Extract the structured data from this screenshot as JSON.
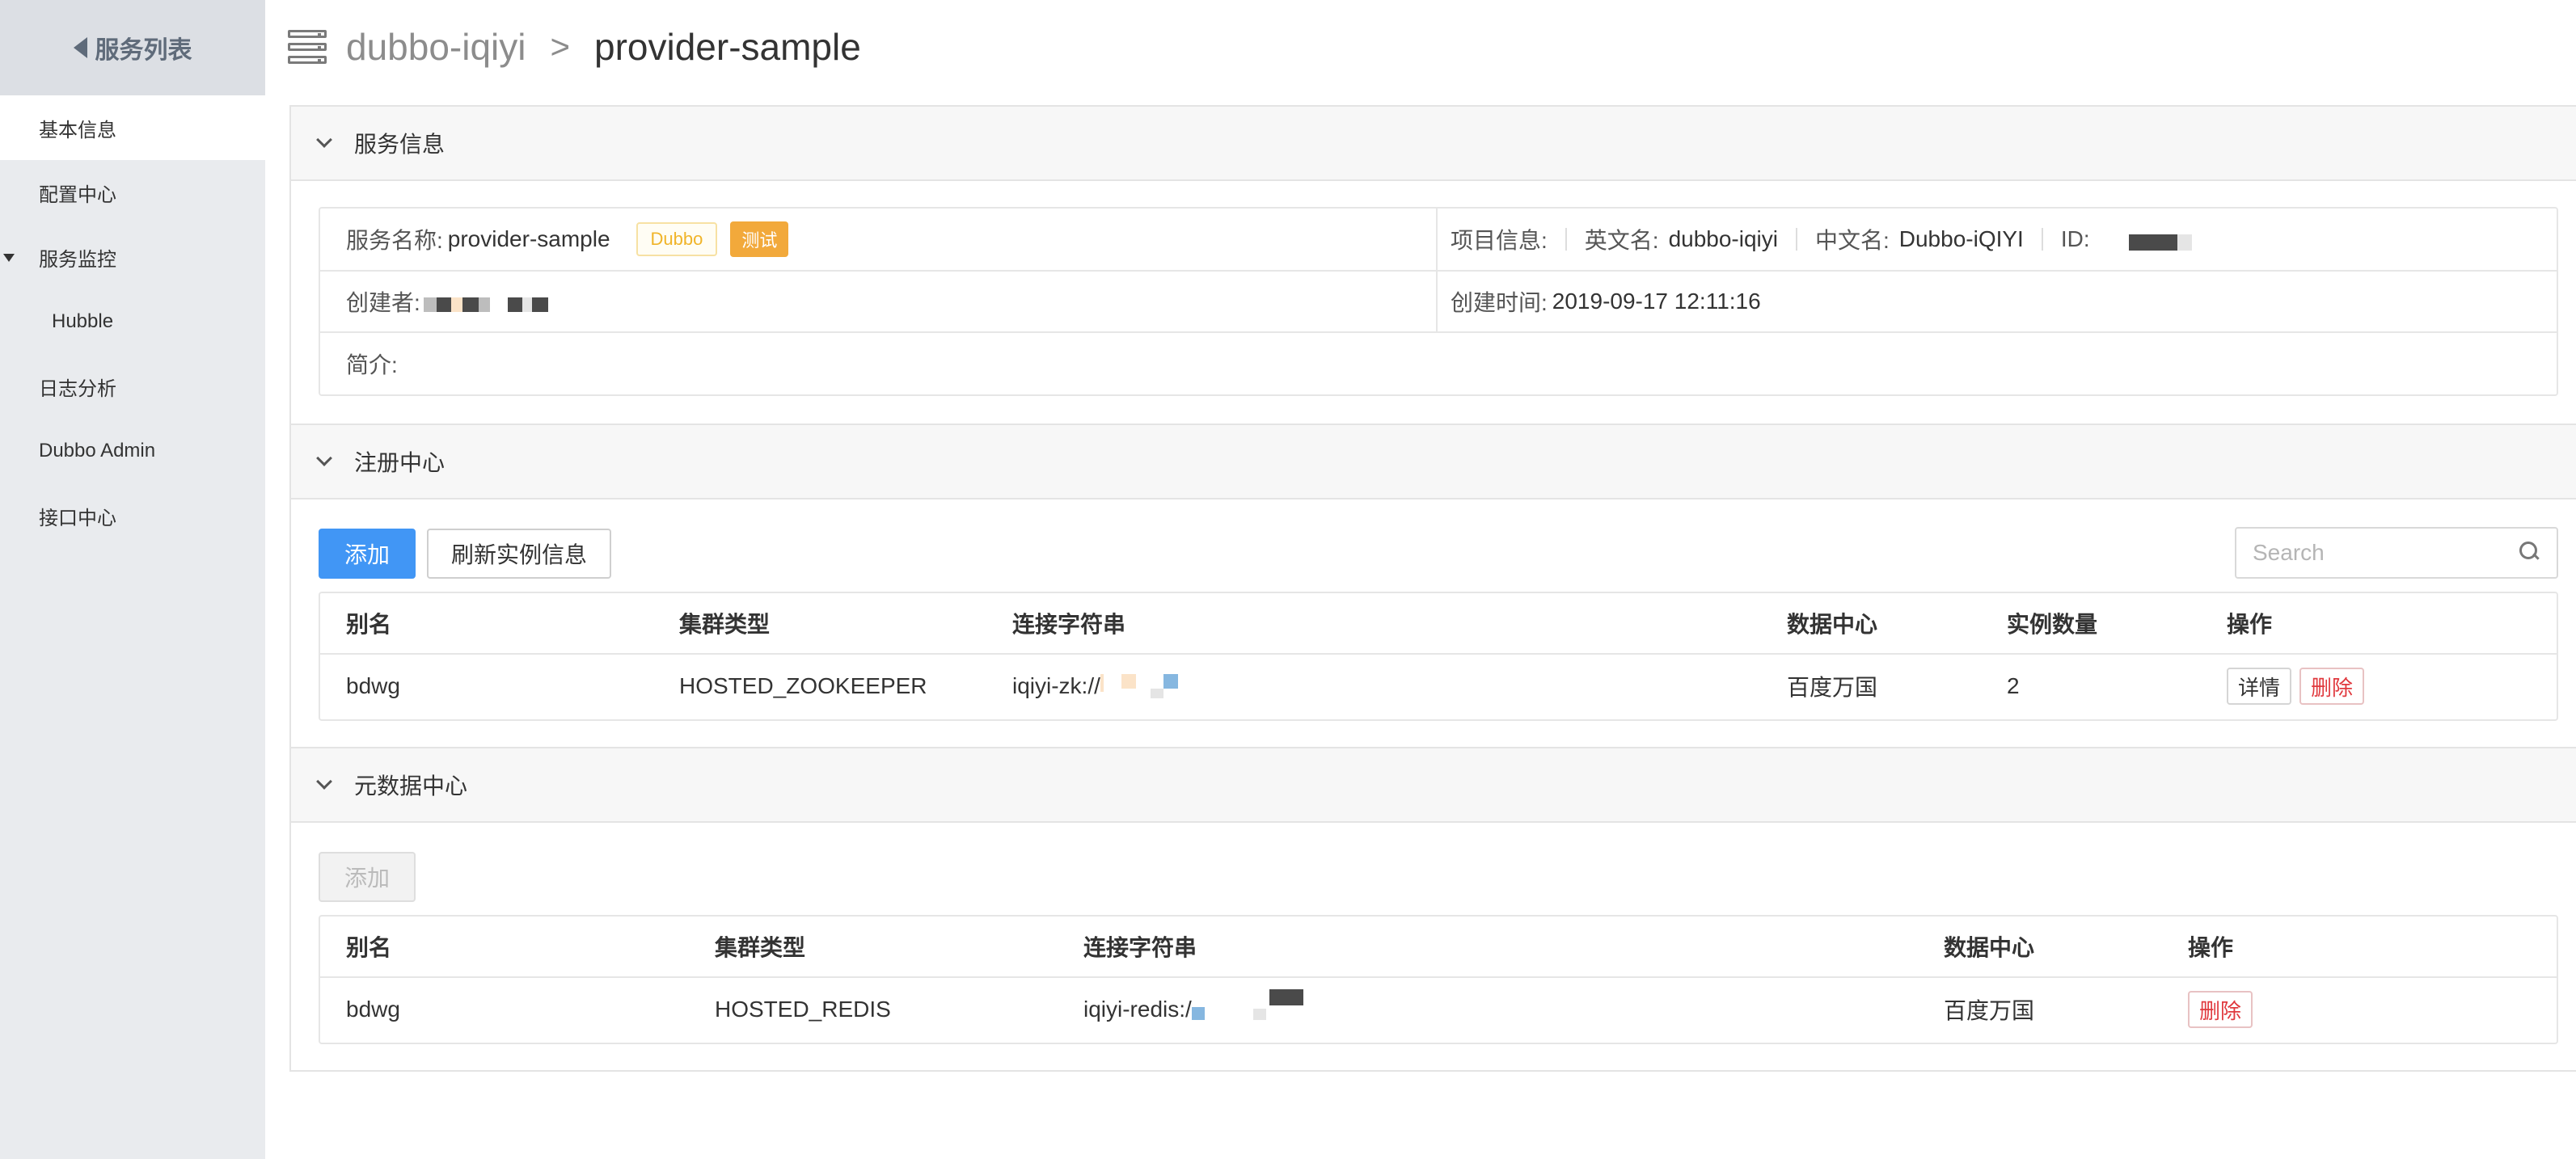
{
  "sidebar": {
    "back_label": "服务列表",
    "items": [
      {
        "label": "基本信息"
      },
      {
        "label": "配置中心"
      },
      {
        "label": "服务监控"
      },
      {
        "label": "Hubble"
      },
      {
        "label": "日志分析"
      },
      {
        "label": "Dubbo Admin"
      },
      {
        "label": "接口中心"
      }
    ]
  },
  "header": {
    "project": "dubbo-iqiyi",
    "separator": ">",
    "service": "provider-sample"
  },
  "service_info": {
    "title": "服务信息",
    "name_label": "服务名称:",
    "name_value": "provider-sample",
    "tag_framework": "Dubbo",
    "tag_env": "测试",
    "project_label": "项目信息:",
    "en_label": "英文名:",
    "en_value": "dubbo-iqiyi",
    "cn_label": "中文名:",
    "cn_value": "Dubbo-iQIYI",
    "id_label": "ID:",
    "creator_label": "创建者:",
    "created_label": "创建时间:",
    "created_value": "2019-09-17 12:11:16",
    "intro_label": "简介:"
  },
  "registry": {
    "title": "注册中心",
    "add_label": "添加",
    "refresh_label": "刷新实例信息",
    "search_placeholder": "Search",
    "columns": [
      "别名",
      "集群类型",
      "连接字符串",
      "数据中心",
      "实例数量",
      "操作"
    ],
    "rows": [
      {
        "alias": "bdwg",
        "cluster_type": "HOSTED_ZOOKEEPER",
        "conn": "iqiyi-zk://",
        "dc": "百度万国",
        "count": "2",
        "detail_label": "详情",
        "delete_label": "删除"
      }
    ]
  },
  "metadata": {
    "title": "元数据中心",
    "add_label": "添加",
    "columns": [
      "别名",
      "集群类型",
      "连接字符串",
      "数据中心",
      "操作"
    ],
    "rows": [
      {
        "alias": "bdwg",
        "cluster_type": "HOSTED_REDIS",
        "conn": "iqiyi-redis:/",
        "dc": "百度万国",
        "delete_label": "删除"
      }
    ]
  }
}
